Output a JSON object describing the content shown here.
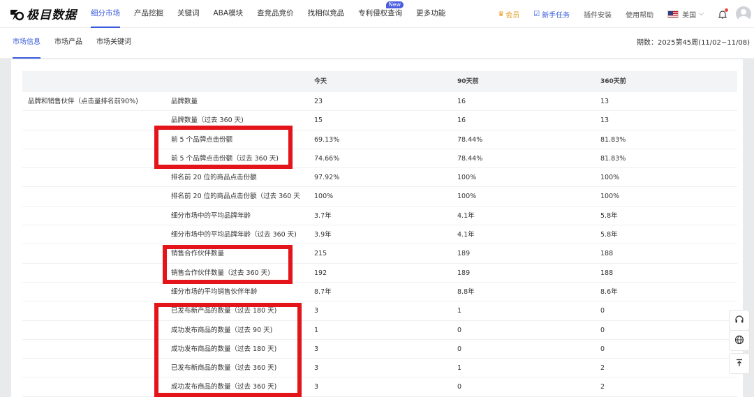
{
  "header": {
    "logo_text": "极目数据",
    "nav": [
      {
        "label": "细分市场",
        "active": true
      },
      {
        "label": "产品挖掘"
      },
      {
        "label": "关键词"
      },
      {
        "label": "ABA模块"
      },
      {
        "label": "查竞品竞价"
      },
      {
        "label": "找相似竞品"
      },
      {
        "label": "专利侵权查询",
        "badge": "New"
      },
      {
        "label": "更多功能"
      }
    ],
    "vip_label": "会员",
    "task_label": "新手任务",
    "plugin_label": "插件安装",
    "help_label": "使用帮助",
    "region_label": "美国"
  },
  "subnav": {
    "tabs": [
      "市场信息",
      "市场产品",
      "市场关键词"
    ],
    "active_index": 0,
    "period": "期数：2025第45周(11/02~11/08)"
  },
  "table": {
    "headers": [
      "",
      "",
      "今天",
      "90天前",
      "360天前"
    ],
    "group_label": "品牌和销售伙伴（点击量排名前90%)",
    "rows": [
      {
        "metric": "品牌数量",
        "today": "23",
        "d90": "16",
        "d360": "13"
      },
      {
        "metric": "品牌数量（过去 360 天)",
        "today": "15",
        "d90": "16",
        "d360": "13"
      },
      {
        "metric": "前 5 个品牌点击份额",
        "today": "69.13%",
        "d90": "78.44%",
        "d360": "81.83%"
      },
      {
        "metric": "前 5 个品牌点击份额（过去 360 天)",
        "today": "74.66%",
        "d90": "78.44%",
        "d360": "81.83%"
      },
      {
        "metric": "排名前 20 位的商品点击份额",
        "today": "97.92%",
        "d90": "100%",
        "d360": "100%"
      },
      {
        "metric": "排名前 20 位的商品点击份额（过去 360 天",
        "today": "100%",
        "d90": "100%",
        "d360": "100%"
      },
      {
        "metric": "细分市场中的平均品牌年龄",
        "today": "3.7年",
        "d90": "4.1年",
        "d360": "5.8年"
      },
      {
        "metric": "细分市场中的平均品牌年龄（过去 360 天)",
        "today": "3.9年",
        "d90": "4.1年",
        "d360": "5.8年"
      },
      {
        "metric": "销售合作伙伴数量",
        "today": "215",
        "d90": "189",
        "d360": "188"
      },
      {
        "metric": "销售合作伙伴数量（过去 360 天)",
        "today": "192",
        "d90": "189",
        "d360": "188"
      },
      {
        "metric": "细分市场的平均销售伙伴年龄",
        "today": "8.7年",
        "d90": "8.8年",
        "d360": "8.6年"
      },
      {
        "metric": "已发布新产品的数量（过去 180 天)",
        "today": "3",
        "d90": "1",
        "d360": "0"
      },
      {
        "metric": "成功发布商品的数量（过去 90 天)",
        "today": "1",
        "d90": "0",
        "d360": "0"
      },
      {
        "metric": "成功发布商品的数量（过去 180 天)",
        "today": "3",
        "d90": "0",
        "d360": "0"
      },
      {
        "metric": "已发布新商品的数量（过去 360 天)",
        "today": "3",
        "d90": "1",
        "d360": "2"
      },
      {
        "metric": "成功发布商品的数量（过去 360 天)",
        "today": "3",
        "d90": "0",
        "d360": "2"
      }
    ]
  },
  "colors": {
    "accent": "#3a5bd9",
    "highlight": "#e3141a",
    "vip": "#e49b1e"
  }
}
